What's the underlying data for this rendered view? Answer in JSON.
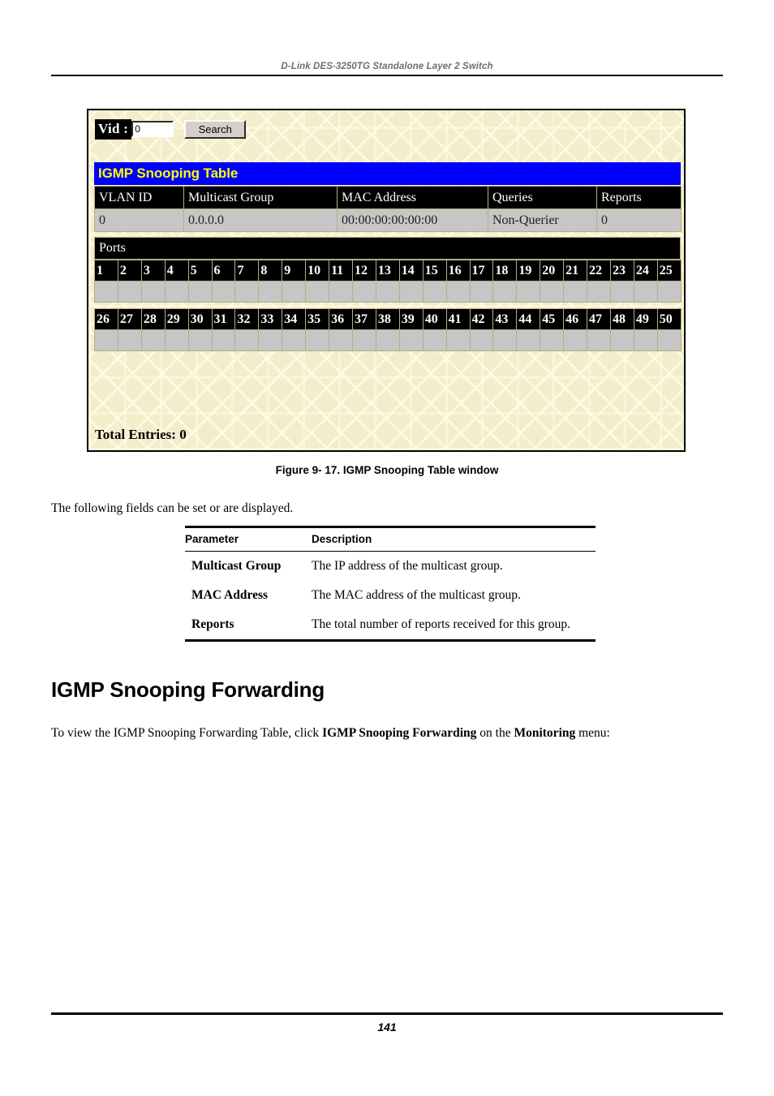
{
  "page": {
    "header_title": "D-Link DES-3250TG Standalone Layer 2 Switch",
    "page_number": "141"
  },
  "screenshot": {
    "search_bar": {
      "vid_label": "Vid :",
      "vid_value": "0",
      "vid_placeholder": "",
      "search_button": "Search"
    },
    "table_title": "IGMP Snooping Table",
    "columns": [
      "VLAN ID",
      "Multicast Group",
      "MAC Address",
      "Queries",
      "Reports"
    ],
    "rows": [
      [
        "0",
        "0.0.0.0",
        "00:00:00:00:00:00",
        "Non-Querier",
        "0"
      ]
    ],
    "ports_label": "Ports",
    "ports_row_1": [
      "1",
      "2",
      "3",
      "4",
      "5",
      "6",
      "7",
      "8",
      "9",
      "10",
      "11",
      "12",
      "13",
      "14",
      "15",
      "16",
      "17",
      "18",
      "19",
      "20",
      "21",
      "22",
      "23",
      "24",
      "25"
    ],
    "ports_row_2": [
      "26",
      "27",
      "28",
      "29",
      "30",
      "31",
      "32",
      "33",
      "34",
      "35",
      "36",
      "37",
      "38",
      "39",
      "40",
      "41",
      "42",
      "43",
      "44",
      "45",
      "46",
      "47",
      "48",
      "49",
      "50"
    ],
    "ports_state_1": [
      "",
      "",
      "",
      "",
      "",
      "",
      "",
      "",
      "",
      "",
      "",
      "",
      "",
      "",
      "",
      "",
      "",
      "",
      "",
      "",
      "",
      "",
      "",
      "",
      ""
    ],
    "ports_state_2": [
      "",
      "",
      "",
      "",
      "",
      "",
      "",
      "",
      "",
      "",
      "",
      "",
      "",
      "",
      "",
      "",
      "",
      "",
      "",
      "",
      "",
      "",
      "",
      "",
      ""
    ],
    "total_entries": "Total Entries: 0",
    "colors": {
      "title_bar_bg": "#0000FF",
      "title_bar_text": "#FFFF00",
      "header_row_bg": "#000000",
      "data_row_bg": "#C6C6C6",
      "window_bg": "#F2EDCB",
      "cell_border": "#B5AE82"
    }
  },
  "figure": {
    "caption": "Figure 9- 17.  IGMP Snooping Table window"
  },
  "intro": {
    "text": "The following fields can be set or are displayed."
  },
  "parameter_table": {
    "headers": [
      "Parameter",
      "Description"
    ],
    "rows": [
      {
        "parameter": "Multicast Group",
        "description": "The IP address of the multicast group."
      },
      {
        "parameter": "MAC Address",
        "description": "The MAC address of the multicast group."
      },
      {
        "parameter": "Reports",
        "description": "The total number of reports received for this group."
      }
    ]
  },
  "section": {
    "heading": "IGMP Snooping Forwarding",
    "paragraph_part1": "To view the IGMP Snooping Forwarding Table, click ",
    "paragraph_bold1": "IGMP Snooping Forwarding",
    "paragraph_part2": " on the ",
    "paragraph_bold2": "Monitoring",
    "paragraph_part3": " menu:"
  }
}
